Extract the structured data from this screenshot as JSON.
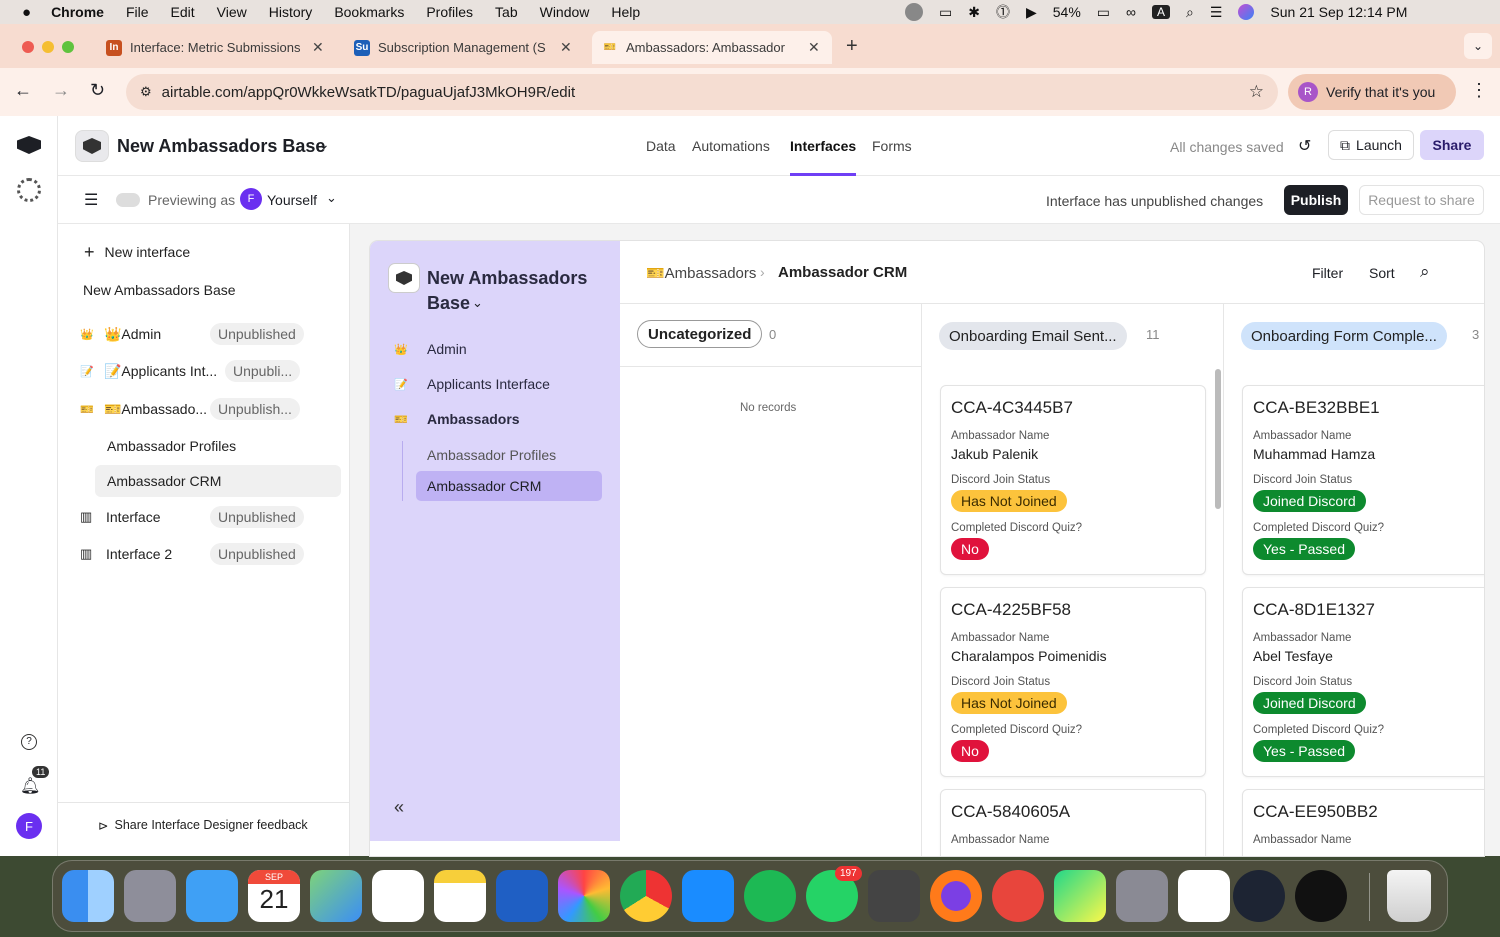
{
  "menubar": {
    "app": "Chrome",
    "items": [
      "File",
      "Edit",
      "View",
      "History",
      "Bookmarks",
      "Profiles",
      "Tab",
      "Window",
      "Help"
    ],
    "battery": "54%",
    "clock": "Sun 21 Sep  12:14 PM",
    "input": "A"
  },
  "tabs": [
    {
      "title": "Interface: Metric Submissions",
      "fav": "In",
      "color": "#c7501f"
    },
    {
      "title": "Subscription Management (S",
      "fav": "Su",
      "color": "#1c5fb8"
    },
    {
      "title": "Ambassadors: Ambassador",
      "fav": "🎫",
      "color": "#d9c9a8"
    }
  ],
  "url": "airtable.com/appQr0WkkeWsatkTD/paguaUjafJ3MkOH9R/edit",
  "verify_label": "Verify that it's you",
  "verify_avatar": "R",
  "header": {
    "base_name": "New Ambassadors Base",
    "nav": [
      "Data",
      "Automations",
      "Interfaces",
      "Forms"
    ],
    "saved": "All changes saved",
    "launch": "Launch",
    "share": "Share"
  },
  "subbar": {
    "previewing": "Previewing as",
    "avatar": "F",
    "user": "Yourself",
    "unpublished_msg": "Interface has unpublished changes",
    "publish": "Publish",
    "request": "Request to share"
  },
  "sidebar": {
    "new_interface": "New interface",
    "base_label": "New Ambassadors Base",
    "items": [
      {
        "icon": "👑",
        "label": "👑Admin",
        "badge": "Unpublished"
      },
      {
        "icon": "📝",
        "label": "📝Applicants Int...",
        "badge": "Unpubli..."
      },
      {
        "icon": "🎫",
        "label": "🎫Ambassado...",
        "badge": "Unpublish..."
      }
    ],
    "sub": [
      "Ambassador Profiles",
      "Ambassador CRM"
    ],
    "others": [
      {
        "label": "Interface",
        "badge": "Unpublished"
      },
      {
        "label": "Interface 2",
        "badge": "Unpublished"
      }
    ],
    "feedback": "Share Interface Designer feedback",
    "notif_count": "11",
    "rail_avatar": "F"
  },
  "inav": {
    "title_line1": "New Ambassadors",
    "title_line2": "Base",
    "items": [
      {
        "icon": "👑",
        "label": "Admin"
      },
      {
        "icon": "📝",
        "label": "Applicants Interface"
      },
      {
        "icon": "🎫",
        "label": "Ambassadors"
      }
    ],
    "sub": [
      "Ambassador Profiles",
      "Ambassador CRM"
    ]
  },
  "breadcrumb": {
    "parent": "🎫Ambassadors",
    "current": "Ambassador CRM",
    "filter": "Filter",
    "sort": "Sort"
  },
  "columns": [
    {
      "title": "Uncategorized",
      "count": "0",
      "empty": "No records"
    },
    {
      "title": "Onboarding Email Sent...",
      "count": "11"
    },
    {
      "title": "Onboarding Form Comple...",
      "count": "3"
    }
  ],
  "field_labels": {
    "name": "Ambassador Name",
    "discord": "Discord Join Status",
    "quiz": "Completed Discord Quiz?"
  },
  "cards_col2": [
    {
      "id": "CCA-4C3445B7",
      "name": "Jakub Palenik",
      "discord": "Has Not Joined",
      "quiz": "No"
    },
    {
      "id": "CCA-4225BF58",
      "name": "Charalampos Poimenidis",
      "discord": "Has Not Joined",
      "quiz": "No"
    },
    {
      "id": "CCA-5840605A"
    }
  ],
  "cards_col3": [
    {
      "id": "CCA-BE32BBE1",
      "name": "Muhammad Hamza",
      "discord": "Joined Discord",
      "quiz": "Yes - Passed"
    },
    {
      "id": "CCA-8D1E1327",
      "name": "Abel Tesfaye",
      "discord": "Joined Discord",
      "quiz": "Yes - Passed"
    },
    {
      "id": "CCA-EE950BB2"
    }
  ],
  "dock": {
    "calendar_month": "SEP",
    "calendar_day": "21",
    "whatsapp_badge": "197"
  }
}
